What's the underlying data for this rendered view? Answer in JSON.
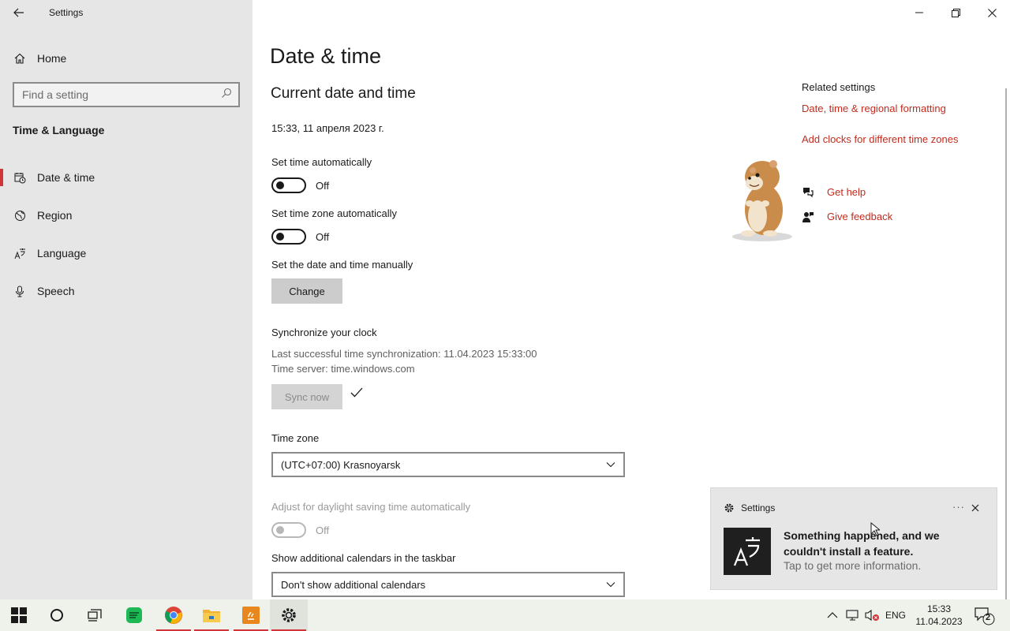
{
  "window": {
    "app_title": "Settings"
  },
  "sidebar": {
    "home_label": "Home",
    "search_placeholder": "Find a setting",
    "section_title": "Time & Language",
    "items": [
      {
        "label": "Date & time",
        "icon": "calendar-clock-icon",
        "active": true
      },
      {
        "label": "Region",
        "icon": "globe-icon",
        "active": false
      },
      {
        "label": "Language",
        "icon": "language-icon",
        "active": false
      },
      {
        "label": "Speech",
        "icon": "microphone-icon",
        "active": false
      }
    ]
  },
  "main": {
    "title": "Date & time",
    "subtitle": "Current date and time",
    "current_datetime": "15:33, 11 апреля 2023 г.",
    "set_time_auto": {
      "label": "Set time automatically",
      "state": "Off"
    },
    "set_zone_auto": {
      "label": "Set time zone automatically",
      "state": "Off"
    },
    "manual": {
      "label": "Set the date and time manually",
      "button": "Change"
    },
    "sync": {
      "title": "Synchronize your clock",
      "last_sync": "Last successful time synchronization: 11.04.2023 15:33:00",
      "server": "Time server: time.windows.com",
      "button": "Sync now"
    },
    "time_zone": {
      "label": "Time zone",
      "value": "(UTC+07:00) Krasnoyarsk"
    },
    "daylight": {
      "label": "Adjust for daylight saving time automatically",
      "state": "Off"
    },
    "calendars": {
      "label": "Show additional calendars in the taskbar",
      "value": "Don't show additional calendars"
    }
  },
  "related": {
    "title": "Related settings",
    "links": [
      "Date, time & regional formatting",
      "Add clocks for different time zones"
    ],
    "help": "Get help",
    "feedback": "Give feedback"
  },
  "toast": {
    "app": "Settings",
    "more": "···",
    "title": "Something happened, and we couldn't install a feature.",
    "subtitle": "Tap to get more information."
  },
  "taskbar": {
    "language": "ENG",
    "time": "15:33",
    "date": "11.04.2023",
    "notification_count": "2"
  },
  "colors": {
    "accent": "#d13438",
    "link": "#c42b1c",
    "sidebar_bg": "#e6e6e6"
  }
}
